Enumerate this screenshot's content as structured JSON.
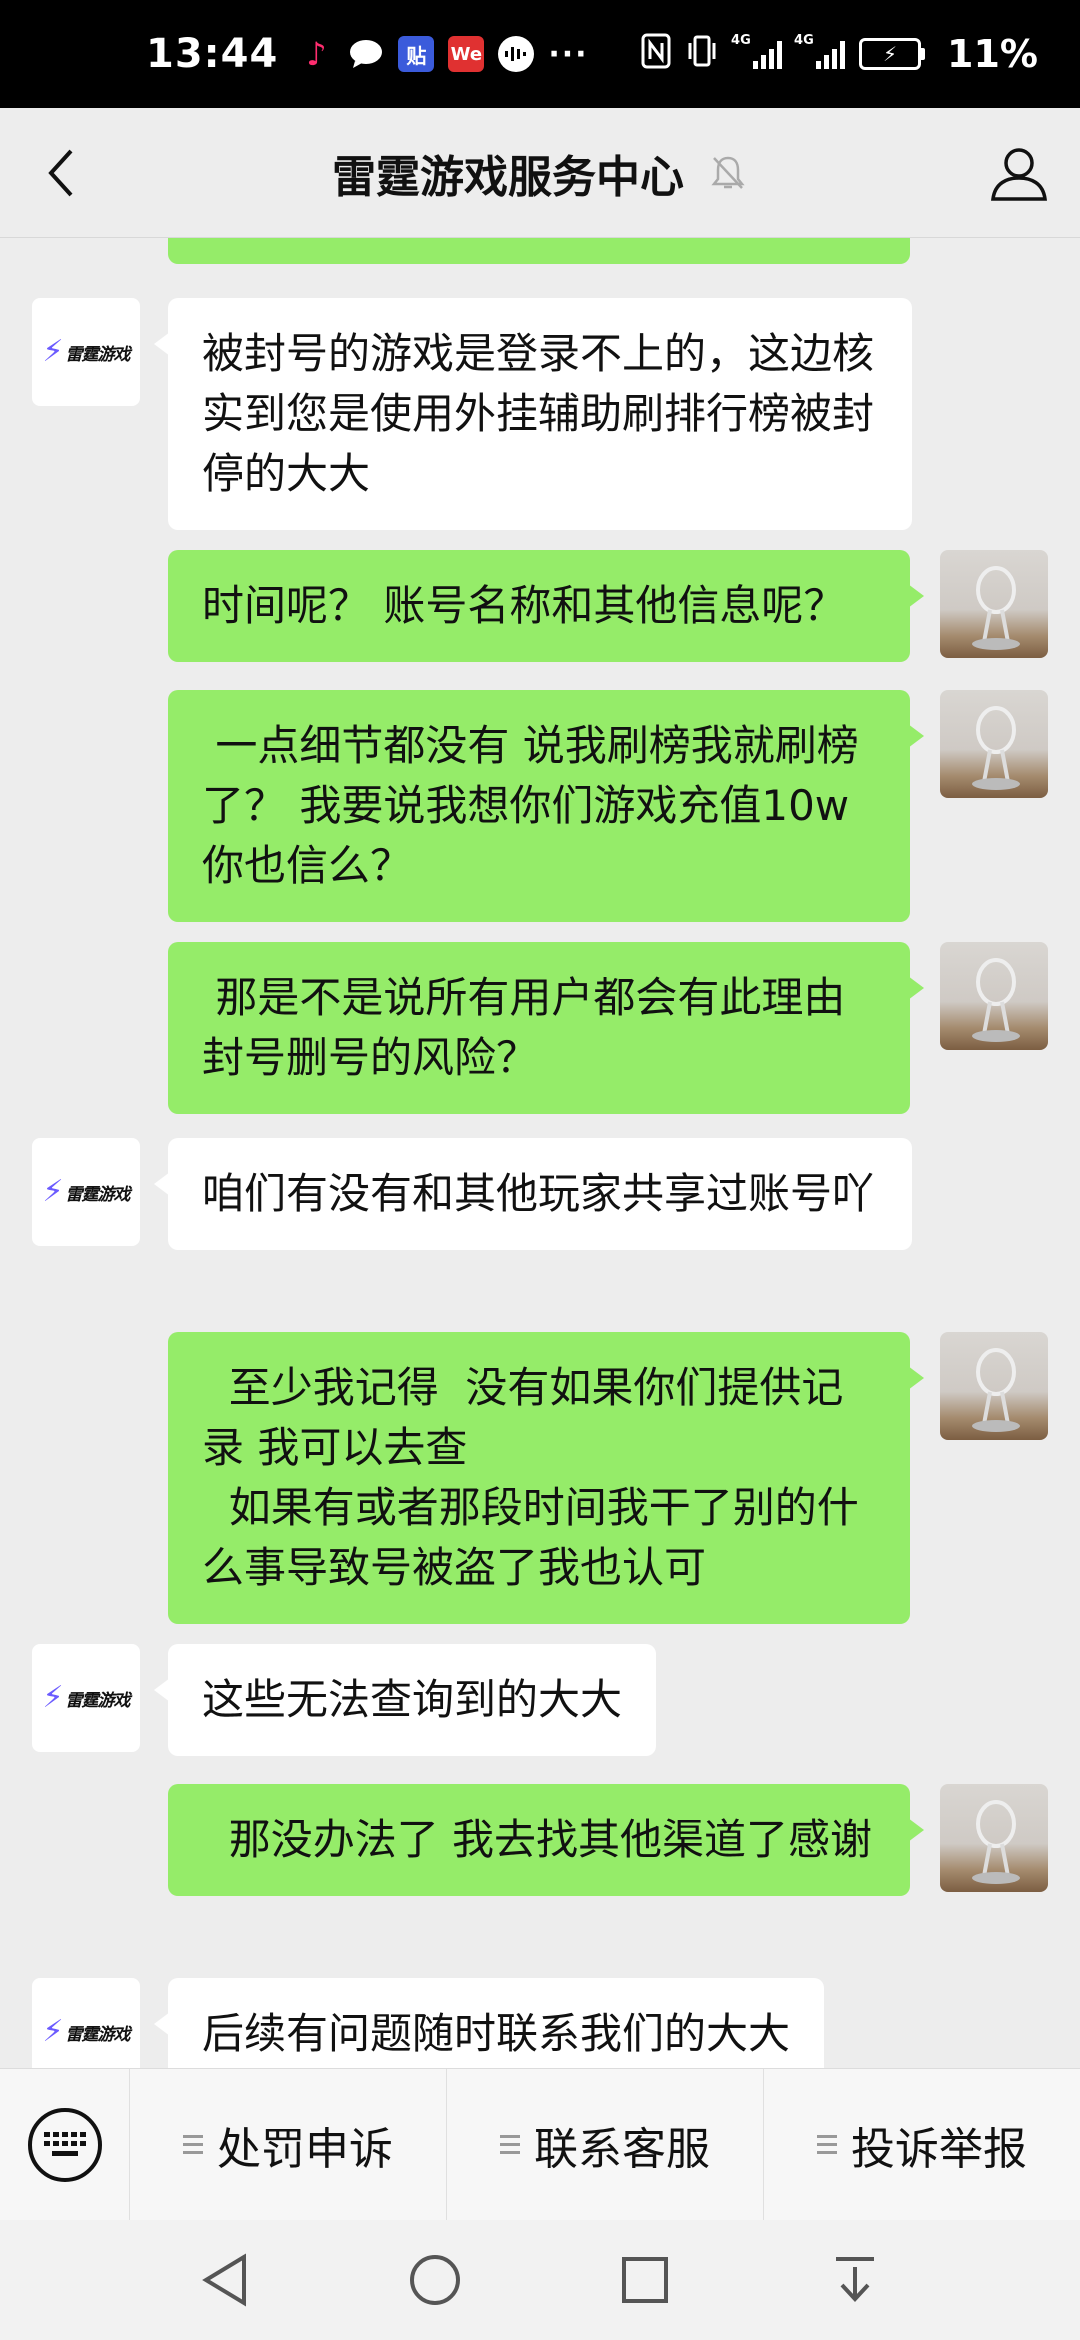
{
  "status_bar": {
    "time": "13:44",
    "more": "···",
    "network_left": "4G",
    "network_right": "4G",
    "battery_percent": "11%",
    "tieba_label": "贴",
    "we_label": "We"
  },
  "header": {
    "title": "雷霆游戏服务中心"
  },
  "bot": {
    "avatar_brand": "雷霆游戏",
    "avatar_bolt": "⚡"
  },
  "messages": [
    {
      "sender": "bot",
      "text": "被封号的游戏是登录不上的，这边核实到您是使用外挂辅助刷排行榜被封停的大大"
    },
    {
      "sender": "me",
      "text": "时间呢？ 账号名称和其他信息呢？"
    },
    {
      "sender": "me",
      "text": " 一点细节都没有 说我刷榜我就刷榜了？ 我要说我想你们游戏充值10w 你也信么？"
    },
    {
      "sender": "me",
      "text": " 那是不是说所有用户都会有此理由封号删号的风险？"
    },
    {
      "sender": "bot",
      "text": "咱们有没有和其他玩家共享过账号吖"
    },
    {
      "sender": "me",
      "text": "  至少我记得  没有如果你们提供记录 我可以去查\n  如果有或者那段时间我干了别的什么事导致号被盗了我也认可"
    },
    {
      "sender": "bot",
      "text": "这些无法查询到的大大"
    },
    {
      "sender": "me",
      "text": "  那没办法了 我去找其他渠道了感谢"
    },
    {
      "sender": "bot",
      "text": "后续有问题随时联系我们的大大"
    }
  ],
  "bottom_menu": {
    "items": [
      {
        "label": "处罚申诉"
      },
      {
        "label": "联系客服"
      },
      {
        "label": "投诉举报"
      }
    ]
  },
  "colors": {
    "my_bubble": "#95ec69",
    "bot_bubble": "#ffffff",
    "background": "#ededed"
  }
}
